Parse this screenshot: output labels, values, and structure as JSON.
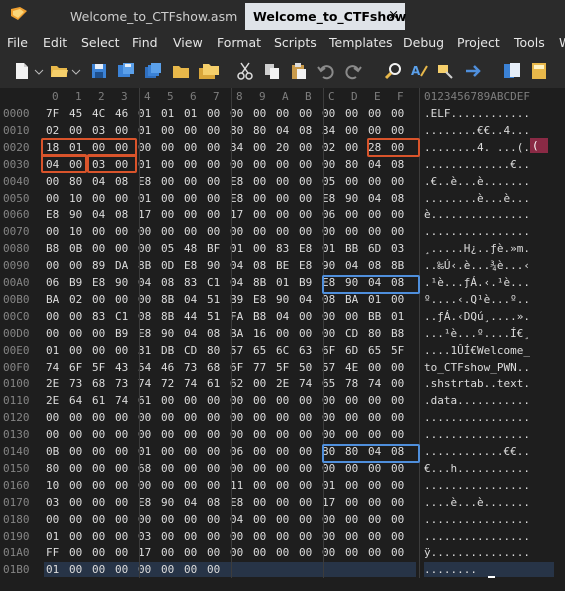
{
  "tabs": [
    {
      "label": "Welcome_to_CTFshow.asm",
      "active": false
    },
    {
      "label": "Welcome_to_CTFshow",
      "active": true,
      "close": "×"
    }
  ],
  "menu": [
    "File",
    "Edit",
    "Select",
    "Find",
    "View",
    "Format",
    "Scripts",
    "Templates",
    "Debug",
    "Project",
    "Tools",
    "W"
  ],
  "toolbar_icons": [
    "new-file-icon",
    "dropdown-icon",
    "open-folder-icon",
    "dropdown-icon",
    "save-icon",
    "save-as-icon",
    "save-all-icon",
    "open-folder-icon",
    "folder-stack-icon",
    "cut-icon",
    "copy-icon",
    "paste-icon",
    "undo-icon",
    "redo-icon",
    "find-icon",
    "replace-icon",
    "find-in-files-icon",
    "goto-icon",
    "compare-icon",
    "calculator-icon"
  ],
  "hex": {
    "columns": [
      "0",
      "1",
      "2",
      "3",
      "4",
      "5",
      "6",
      "7",
      "8",
      "9",
      "A",
      "B",
      "C",
      "D",
      "E",
      "F"
    ],
    "ascii_header": "0123456789ABCDEF",
    "rows": [
      {
        "addr": "0000",
        "bytes": [
          "7F",
          "45",
          "4C",
          "46",
          "01",
          "01",
          "01",
          "00",
          "00",
          "00",
          "00",
          "00",
          "00",
          "00",
          "00",
          "00"
        ],
        "ascii": ".ELF............"
      },
      {
        "addr": "0010",
        "bytes": [
          "02",
          "00",
          "03",
          "00",
          "01",
          "00",
          "00",
          "00",
          "80",
          "80",
          "04",
          "08",
          "34",
          "00",
          "00",
          "00"
        ],
        "ascii": "........€€..4..."
      },
      {
        "addr": "0020",
        "bytes": [
          "18",
          "01",
          "00",
          "00",
          "00",
          "00",
          "00",
          "00",
          "34",
          "00",
          "20",
          "00",
          "02",
          "00",
          "28",
          "00"
        ],
        "ascii": "........4. ...(."
      },
      {
        "addr": "0030",
        "bytes": [
          "04",
          "00",
          "03",
          "00",
          "01",
          "00",
          "00",
          "00",
          "00",
          "00",
          "00",
          "00",
          "00",
          "80",
          "04",
          "08"
        ],
        "ascii": ".............€.."
      },
      {
        "addr": "0040",
        "bytes": [
          "00",
          "80",
          "04",
          "08",
          "E8",
          "00",
          "00",
          "00",
          "E8",
          "00",
          "00",
          "00",
          "05",
          "00",
          "00",
          "00"
        ],
        "ascii": ".€..è...è......."
      },
      {
        "addr": "0050",
        "bytes": [
          "00",
          "10",
          "00",
          "00",
          "01",
          "00",
          "00",
          "00",
          "E8",
          "00",
          "00",
          "00",
          "E8",
          "90",
          "04",
          "08"
        ],
        "ascii": "........è...è..."
      },
      {
        "addr": "0060",
        "bytes": [
          "E8",
          "90",
          "04",
          "08",
          "17",
          "00",
          "00",
          "00",
          "17",
          "00",
          "00",
          "00",
          "06",
          "00",
          "00",
          "00"
        ],
        "ascii": "è..............."
      },
      {
        "addr": "0070",
        "bytes": [
          "00",
          "10",
          "00",
          "00",
          "00",
          "00",
          "00",
          "00",
          "00",
          "00",
          "00",
          "00",
          "00",
          "00",
          "00",
          "00"
        ],
        "ascii": "................"
      },
      {
        "addr": "0080",
        "bytes": [
          "B8",
          "0B",
          "00",
          "00",
          "00",
          "05",
          "48",
          "BF",
          "01",
          "00",
          "83",
          "E8",
          "01",
          "BB",
          "6D",
          "03"
        ],
        "ascii": "¸.....H¿..ƒè.»m."
      },
      {
        "addr": "0090",
        "bytes": [
          "00",
          "00",
          "89",
          "DA",
          "8B",
          "0D",
          "E8",
          "90",
          "04",
          "08",
          "BE",
          "E8",
          "90",
          "04",
          "08",
          "8B"
        ],
        "ascii": "..‰Ú‹.è...¾è...‹"
      },
      {
        "addr": "00A0",
        "bytes": [
          "06",
          "B9",
          "E8",
          "90",
          "04",
          "08",
          "83",
          "C1",
          "04",
          "8B",
          "01",
          "B9",
          "E8",
          "90",
          "04",
          "08"
        ],
        "ascii": ".¹è...ƒÁ.‹.¹è..."
      },
      {
        "addr": "00B0",
        "bytes": [
          "BA",
          "02",
          "00",
          "00",
          "00",
          "8B",
          "04",
          "51",
          "B9",
          "E8",
          "90",
          "04",
          "08",
          "BA",
          "01",
          "00"
        ],
        "ascii": "º....‹.Q¹è...º.."
      },
      {
        "addr": "00C0",
        "bytes": [
          "00",
          "00",
          "83",
          "C1",
          "08",
          "8B",
          "44",
          "51",
          "FA",
          "B8",
          "04",
          "00",
          "00",
          "00",
          "BB",
          "01"
        ],
        "ascii": "..ƒÁ.‹DQú¸....»."
      },
      {
        "addr": "00D0",
        "bytes": [
          "00",
          "00",
          "00",
          "B9",
          "E8",
          "90",
          "04",
          "08",
          "BA",
          "16",
          "00",
          "00",
          "00",
          "CD",
          "80",
          "B8"
        ],
        "ascii": "...¹è...º....Í€¸"
      },
      {
        "addr": "00E0",
        "bytes": [
          "01",
          "00",
          "00",
          "00",
          "31",
          "DB",
          "CD",
          "80",
          "57",
          "65",
          "6C",
          "63",
          "6F",
          "6D",
          "65",
          "5F"
        ],
        "ascii": "....1ÛÍ€Welcome_"
      },
      {
        "addr": "00F0",
        "bytes": [
          "74",
          "6F",
          "5F",
          "43",
          "54",
          "46",
          "73",
          "68",
          "6F",
          "77",
          "5F",
          "50",
          "57",
          "4E",
          "00",
          "00"
        ],
        "ascii": "to_CTFshow_PWN.."
      },
      {
        "addr": "0100",
        "bytes": [
          "2E",
          "73",
          "68",
          "73",
          "74",
          "72",
          "74",
          "61",
          "62",
          "00",
          "2E",
          "74",
          "65",
          "78",
          "74",
          "00"
        ],
        "ascii": ".shstrtab..text."
      },
      {
        "addr": "0110",
        "bytes": [
          "2E",
          "64",
          "61",
          "74",
          "61",
          "00",
          "00",
          "00",
          "00",
          "00",
          "00",
          "00",
          "00",
          "00",
          "00",
          "00"
        ],
        "ascii": ".data..........."
      },
      {
        "addr": "0120",
        "bytes": [
          "00",
          "00",
          "00",
          "00",
          "00",
          "00",
          "00",
          "00",
          "00",
          "00",
          "00",
          "00",
          "00",
          "00",
          "00",
          "00"
        ],
        "ascii": "................"
      },
      {
        "addr": "0130",
        "bytes": [
          "00",
          "00",
          "00",
          "00",
          "00",
          "00",
          "00",
          "00",
          "00",
          "00",
          "00",
          "00",
          "00",
          "00",
          "00",
          "00"
        ],
        "ascii": "................"
      },
      {
        "addr": "0140",
        "bytes": [
          "0B",
          "00",
          "00",
          "00",
          "01",
          "00",
          "00",
          "00",
          "06",
          "00",
          "00",
          "00",
          "80",
          "80",
          "04",
          "08"
        ],
        "ascii": "............€€.."
      },
      {
        "addr": "0150",
        "bytes": [
          "80",
          "00",
          "00",
          "00",
          "68",
          "00",
          "00",
          "00",
          "00",
          "00",
          "00",
          "00",
          "00",
          "00",
          "00",
          "00"
        ],
        "ascii": "€...h..........."
      },
      {
        "addr": "0160",
        "bytes": [
          "10",
          "00",
          "00",
          "00",
          "00",
          "00",
          "00",
          "00",
          "11",
          "00",
          "00",
          "00",
          "01",
          "00",
          "00",
          "00"
        ],
        "ascii": "................"
      },
      {
        "addr": "0170",
        "bytes": [
          "03",
          "00",
          "00",
          "00",
          "E8",
          "90",
          "04",
          "08",
          "E8",
          "00",
          "00",
          "00",
          "17",
          "00",
          "00",
          "00"
        ],
        "ascii": "....è...è......."
      },
      {
        "addr": "0180",
        "bytes": [
          "00",
          "00",
          "00",
          "00",
          "00",
          "00",
          "00",
          "00",
          "04",
          "00",
          "00",
          "00",
          "00",
          "00",
          "00",
          "00"
        ],
        "ascii": "................"
      },
      {
        "addr": "0190",
        "bytes": [
          "01",
          "00",
          "00",
          "00",
          "03",
          "00",
          "00",
          "00",
          "00",
          "00",
          "00",
          "00",
          "00",
          "00",
          "00",
          "00"
        ],
        "ascii": "................"
      },
      {
        "addr": "01A0",
        "bytes": [
          "FF",
          "00",
          "00",
          "00",
          "17",
          "00",
          "00",
          "00",
          "00",
          "00",
          "00",
          "00",
          "00",
          "00",
          "00",
          "00"
        ],
        "ascii": "ÿ..............."
      },
      {
        "addr": "01B0",
        "bytes": [
          "01",
          "00",
          "00",
          "00",
          "00",
          "00",
          "00",
          "00"
        ],
        "ascii": "........"
      }
    ]
  },
  "colors": {
    "highlight_red": "#d9542b",
    "highlight_blue": "#4f8fdc",
    "ascii_mark": "#8a2a45"
  }
}
